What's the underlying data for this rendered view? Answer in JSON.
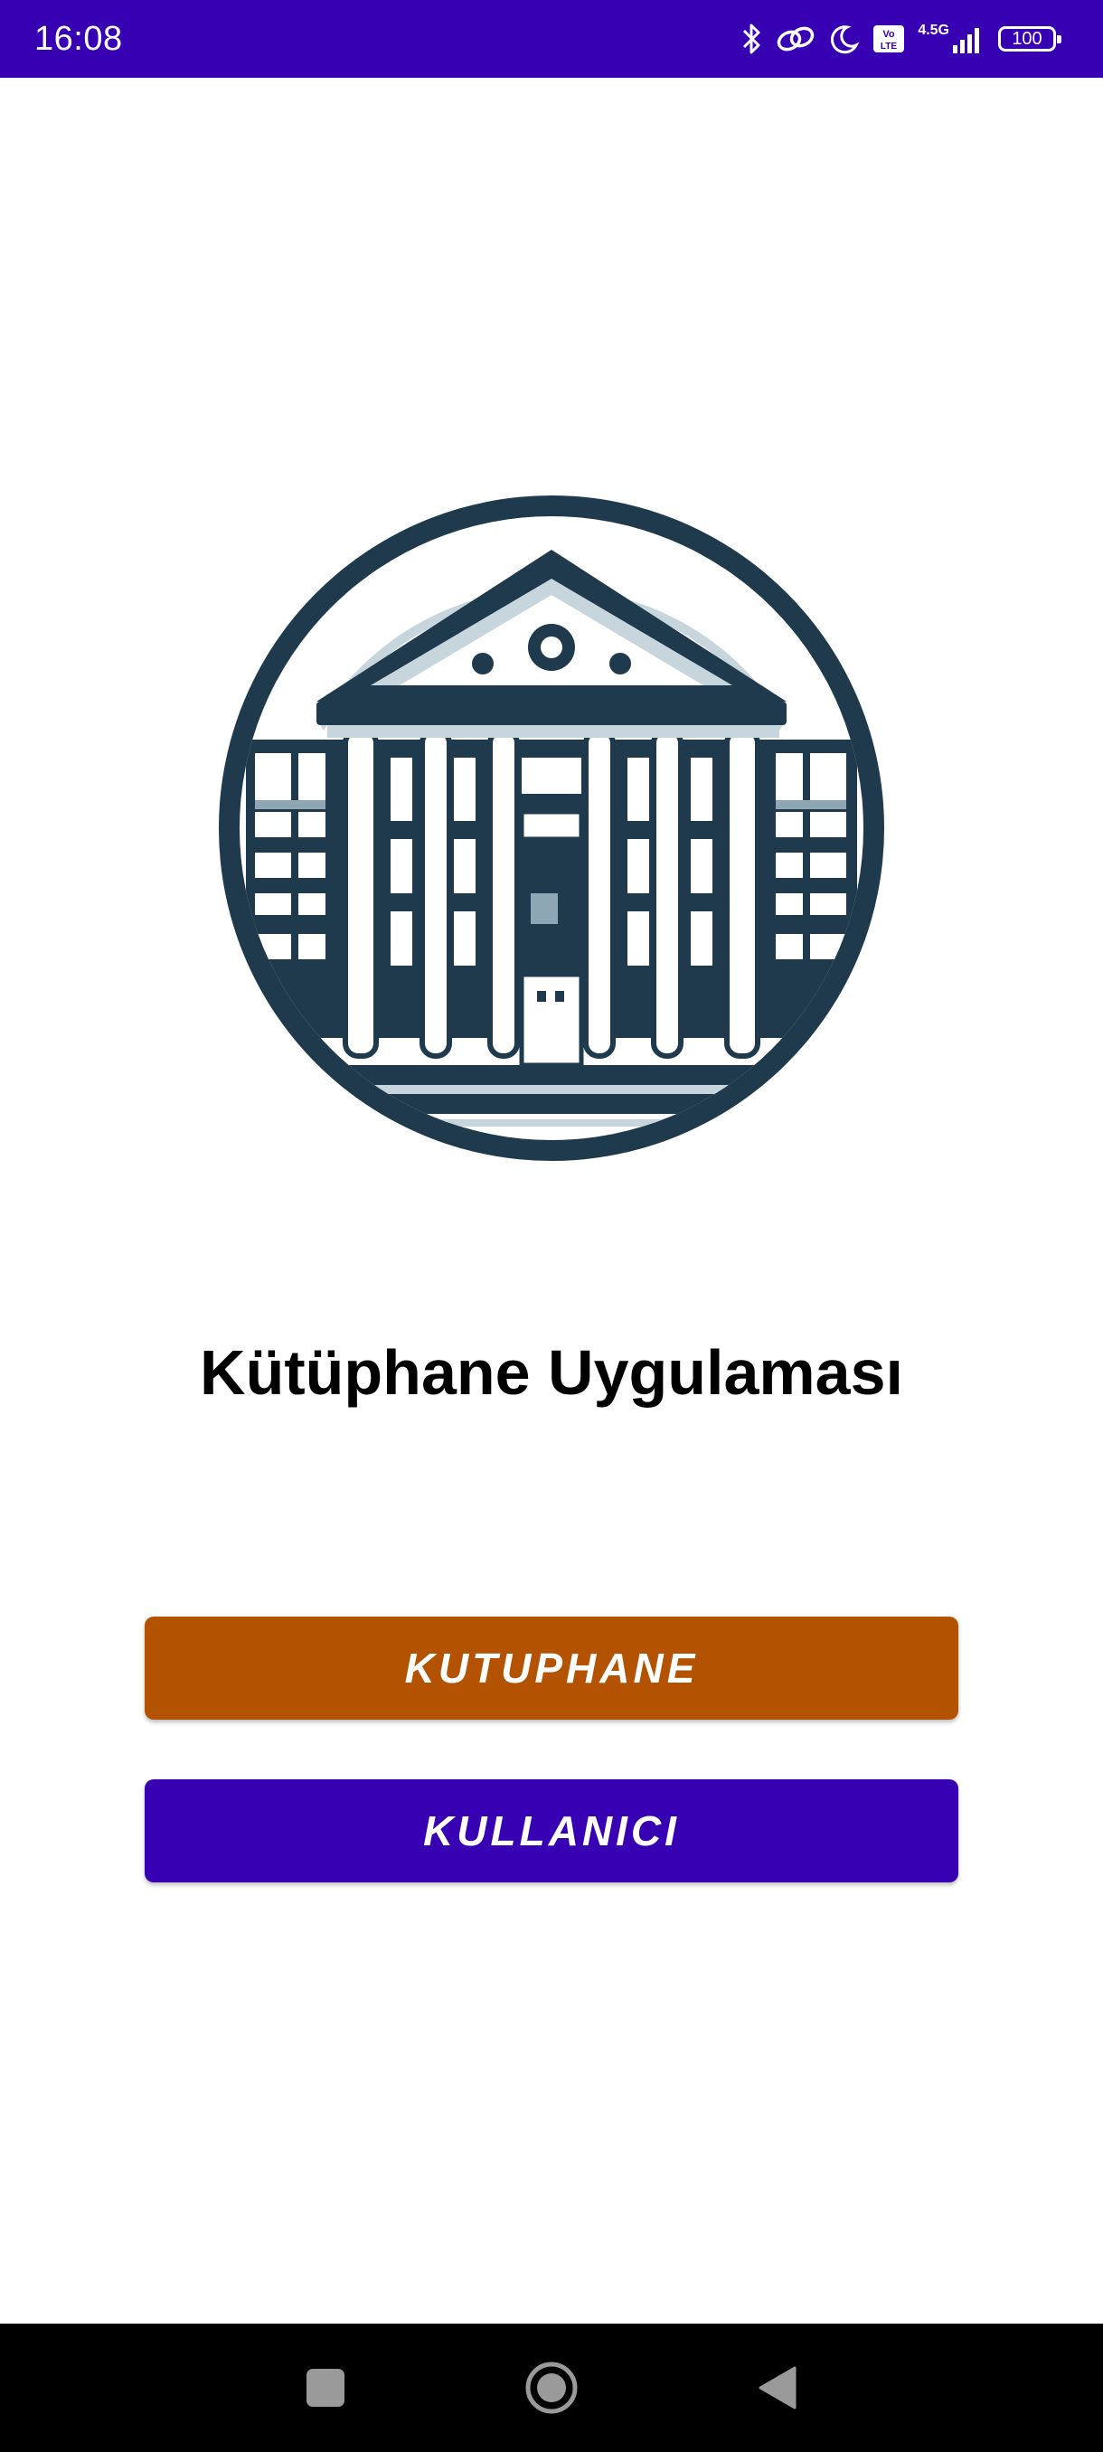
{
  "status_bar": {
    "time": "16:08",
    "network_label": "4.5G",
    "battery": "100",
    "icons": [
      "bluetooth-icon",
      "link-icon",
      "moon-icon",
      "volte-icon",
      "signal-icon",
      "battery-icon"
    ]
  },
  "main": {
    "logo": "library-building-icon",
    "title": "Kütüphane Uygulaması",
    "buttons": {
      "library": "KUTUPHANE",
      "user": "KULLANICI"
    }
  },
  "nav_bar": {
    "icons": [
      "recents-square-icon",
      "home-circle-icon",
      "back-triangle-icon"
    ]
  },
  "colors": {
    "status_bar": "#3700B3",
    "library_button": "#B35200",
    "user_button": "#3700B3",
    "logo_dark": "#1E3A4C",
    "logo_light": "#C7D5DD"
  }
}
